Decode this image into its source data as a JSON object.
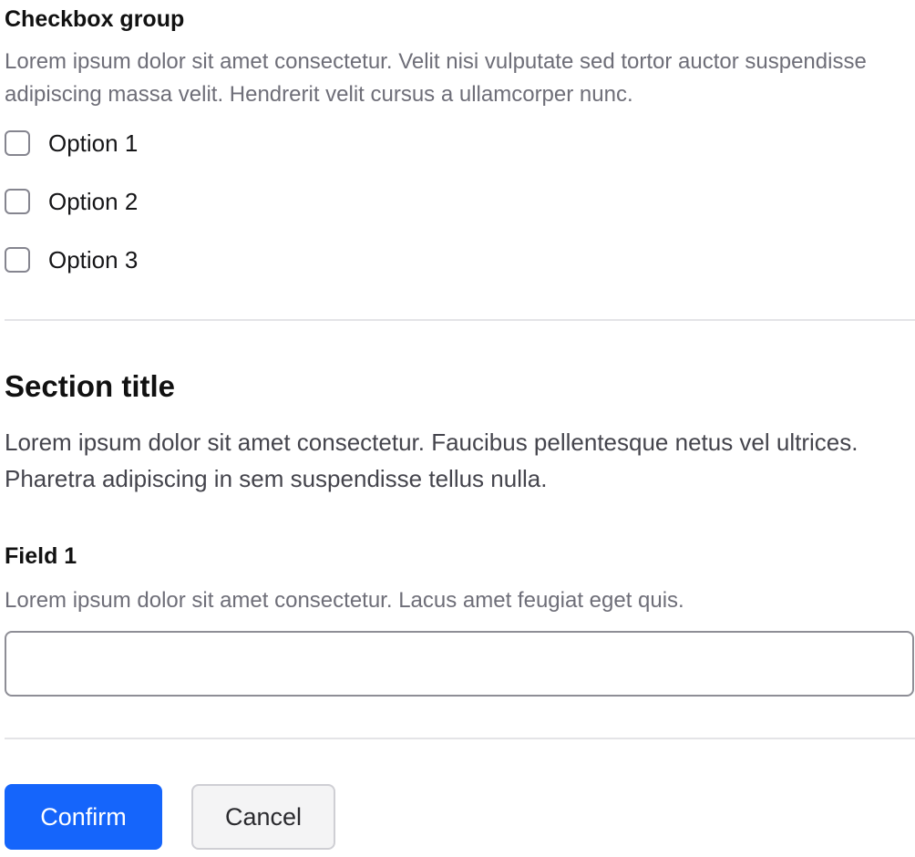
{
  "checkbox_group": {
    "title": "Checkbox group",
    "description": "Lorem ipsum dolor sit amet consectetur. Velit nisi vulputate sed tortor auctor suspendisse adipiscing massa velit. Hendrerit velit cursus a ullamcorper nunc.",
    "options": [
      {
        "label": "Option 1",
        "checked": false
      },
      {
        "label": "Option 2",
        "checked": false
      },
      {
        "label": "Option 3",
        "checked": false
      }
    ]
  },
  "section": {
    "title": "Section title",
    "description": "Lorem ipsum dolor sit amet consectetur. Faucibus pellentesque netus vel ultrices. Pharetra adipiscing in sem suspendisse tellus nulla."
  },
  "field1": {
    "label": "Field 1",
    "help": "Lorem ipsum dolor sit amet consectetur. Lacus amet feugiat eget quis.",
    "value": "",
    "placeholder": ""
  },
  "actions": {
    "confirm_label": "Confirm",
    "cancel_label": "Cancel"
  },
  "colors": {
    "primary": "#1565fb",
    "secondary_bg": "#f4f4f5",
    "muted_text": "#6e6e78",
    "divider": "#e4e4e7"
  }
}
